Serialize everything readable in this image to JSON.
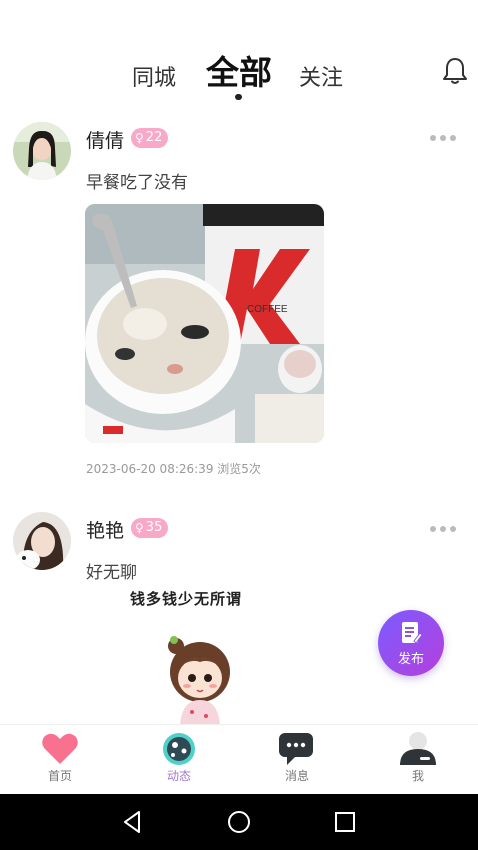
{
  "header": {
    "tabs": [
      {
        "label": "同城",
        "active": false
      },
      {
        "label": "全部",
        "active": true
      },
      {
        "label": "关注",
        "active": false
      }
    ]
  },
  "posts": [
    {
      "username": "倩倩",
      "age": "22",
      "gender_icon": "female-icon",
      "content": "早餐吃了没有",
      "timestamp": "2023-06-20 08:26:39",
      "views": "浏览5次"
    },
    {
      "username": "艳艳",
      "age": "35",
      "gender_icon": "female-icon",
      "content": "好无聊",
      "banner_text": "钱多钱少无所谓"
    }
  ],
  "fab": {
    "label": "发布"
  },
  "bottom_nav": [
    {
      "label": "首页",
      "icon": "heart-icon",
      "active": false
    },
    {
      "label": "动态",
      "icon": "planet-icon",
      "active": true
    },
    {
      "label": "消息",
      "icon": "chat-icon",
      "active": false
    },
    {
      "label": "我",
      "icon": "person-icon",
      "active": false
    }
  ],
  "colors": {
    "badge": "#f7a9c7",
    "fab_start": "#7b5cff",
    "fab_end": "#b53fdc",
    "nav_active": "#a47ad0",
    "heart": "#f8718f"
  }
}
